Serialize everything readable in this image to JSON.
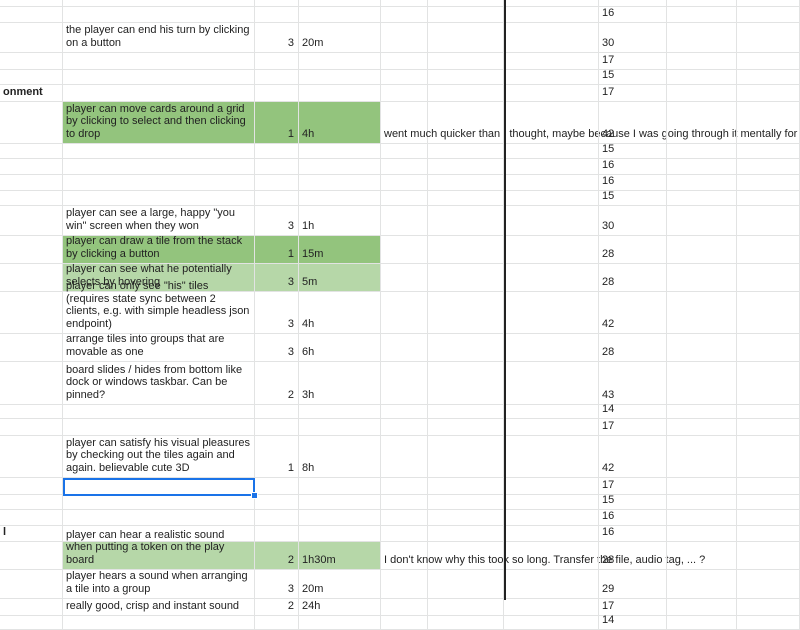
{
  "colors": {
    "done_dark": "#93c47d",
    "done_light": "#b6d7a8",
    "selection": "#1a73e8",
    "gridline": "#e2e3e3"
  },
  "rows": [
    {
      "h": 7,
      "a": "",
      "b": "",
      "c": "",
      "d": "",
      "e": "",
      "a_text": "-"
    },
    {
      "h": 16,
      "a": "",
      "b": "",
      "c": "",
      "d": "",
      "e": ""
    },
    {
      "h": 30,
      "a": "",
      "b": "the player can end his turn by clicking on a button",
      "c": "3",
      "d": "20m",
      "e": ""
    },
    {
      "h": 17,
      "a": "",
      "b": "",
      "c": "",
      "d": "",
      "e": ""
    },
    {
      "h": 15,
      "a": "",
      "b": "",
      "c": "",
      "d": "",
      "e": ""
    },
    {
      "h": 17,
      "a": "onment",
      "bold": true,
      "b": "",
      "c": "",
      "d": "",
      "e": ""
    },
    {
      "h": 42,
      "a": "",
      "b": "player can move cards around a grid by clicking to select and then clicking to drop",
      "c": "1",
      "d": "4h",
      "e": "went much quicker than I thought, maybe because I was going through it mentally for weeks",
      "fill": "dark"
    },
    {
      "h": 15,
      "a": "",
      "b": "",
      "c": "",
      "d": "",
      "e": ""
    },
    {
      "h": 16,
      "a": "",
      "b": "",
      "c": "",
      "d": "",
      "e": ""
    },
    {
      "h": 16,
      "a": "",
      "b": "",
      "c": "",
      "d": "",
      "e": ""
    },
    {
      "h": 15,
      "a": "",
      "b": "",
      "c": "",
      "d": "",
      "e": ""
    },
    {
      "h": 30,
      "a": "",
      "b": "player can see a large, happy \"you win\" screen when they won",
      "c": "3",
      "d": "1h",
      "e": ""
    },
    {
      "h": 28,
      "a": "",
      "b": "player can draw a tile from the stack by clicking a button",
      "c": "1",
      "d": "15m",
      "e": "",
      "fill": "dark"
    },
    {
      "h": 28,
      "a": "",
      "b": "player can see what he potentially selects by hovering",
      "c": "3",
      "d": "5m",
      "e": "",
      "fill": "light"
    },
    {
      "h": 42,
      "a": "",
      "b": "player can only see \"his\" tiles (requires state sync between 2 clients, e.g. with simple headless json endpoint)",
      "c": "3",
      "d": "4h",
      "e": ""
    },
    {
      "h": 28,
      "a": "",
      "b": "arrange tiles into groups that are movable as one",
      "c": "3",
      "d": "6h",
      "e": ""
    },
    {
      "h": 43,
      "a": "",
      "b": "board slides / hides from bottom like dock or windows taskbar. Can be pinned?",
      "c": "2",
      "d": "3h",
      "e": ""
    },
    {
      "h": 14,
      "a": "",
      "b": "",
      "c": "",
      "d": "",
      "e": ""
    },
    {
      "h": 17,
      "a": "",
      "b": "",
      "c": "",
      "d": "",
      "e": ""
    },
    {
      "h": 42,
      "a": "",
      "b": "player can satisfy his visual pleasures by checking out the tiles again and again. believable cute 3D",
      "c": "1",
      "d": "8h",
      "e": ""
    },
    {
      "h": 17,
      "a": "",
      "b": "",
      "c": "",
      "d": "",
      "e": "",
      "selected": true
    },
    {
      "h": 15,
      "a": "",
      "b": "",
      "c": "",
      "d": "",
      "e": ""
    },
    {
      "h": 16,
      "a": "",
      "b": "",
      "c": "",
      "d": "",
      "e": ""
    },
    {
      "h": 16,
      "a": "l",
      "bold": true,
      "b": "",
      "c": "",
      "d": "",
      "e": ""
    },
    {
      "h": 28,
      "a": "",
      "b": "player can hear a realistic sound when putting a token on the play board",
      "c": "2",
      "d": "1h30m",
      "e": "I don't know why this took so long. Transfer the file, audio tag, ... ?",
      "fill": "light"
    },
    {
      "h": 29,
      "a": "",
      "b": "player hears a sound when arranging a tile into a group",
      "c": "3",
      "d": "20m",
      "e": ""
    },
    {
      "h": 17,
      "a": "",
      "b": "really good, crisp and instant sound",
      "c": "2",
      "d": "24h",
      "e": ""
    },
    {
      "h": 14,
      "a": "",
      "b": "",
      "c": "",
      "d": "",
      "e": ""
    }
  ]
}
